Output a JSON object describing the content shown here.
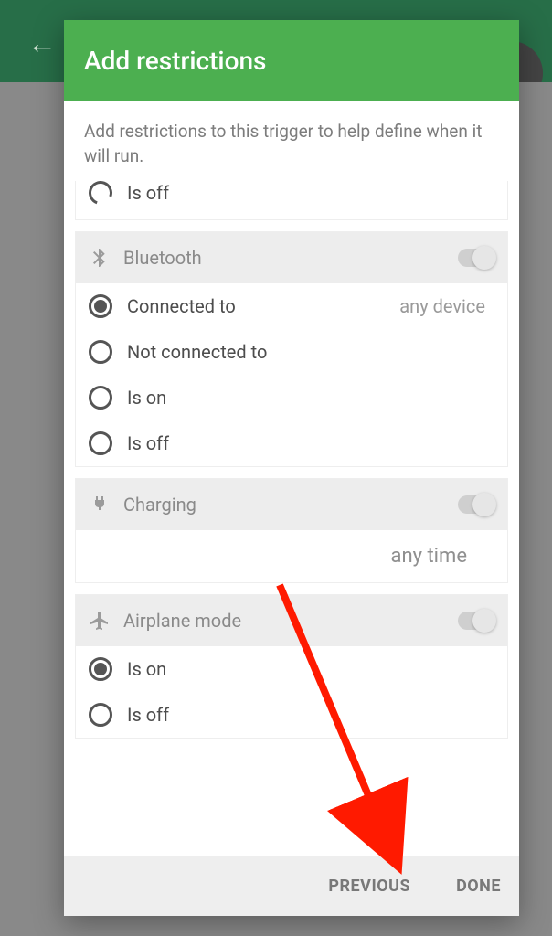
{
  "dialog": {
    "title": "Add restrictions",
    "description": "Add restrictions to this trigger to help define when it will run."
  },
  "partial_option": {
    "label": "Is off"
  },
  "sections": {
    "bluetooth": {
      "title": "Bluetooth",
      "options": {
        "connected": {
          "label": "Connected to",
          "extra": "any device"
        },
        "not_connected": {
          "label": "Not connected to"
        },
        "is_on": {
          "label": "Is on"
        },
        "is_off": {
          "label": "Is off"
        }
      }
    },
    "charging": {
      "title": "Charging",
      "subtext": "any time"
    },
    "airplane": {
      "title": "Airplane mode",
      "options": {
        "is_on": {
          "label": "Is on"
        },
        "is_off": {
          "label": "Is off"
        }
      }
    }
  },
  "footer": {
    "previous": "PREVIOUS",
    "done": "DONE"
  },
  "annotation": {
    "arrow_color": "#ff1a00"
  }
}
